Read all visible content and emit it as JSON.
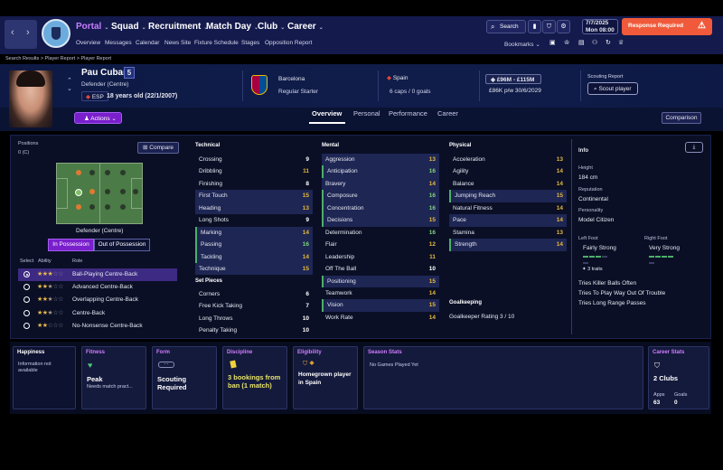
{
  "header": {
    "menus": [
      "Portal",
      "Squad",
      "Recruitment",
      "Match Day",
      "Club",
      "Career"
    ],
    "submenu": [
      "Overview",
      "Messages",
      "Calendar",
      "News Site",
      "Fixture Schedule",
      "Stages",
      "Opposition Report"
    ],
    "search_label": "Search",
    "date_line1": "7/7/2025",
    "date_line2": "Mon  08:00",
    "response_label": "Response Required",
    "bookmarks_label": "Bookmarks"
  },
  "breadcrumb": "Search Results  >  Player Report  >  Player Report",
  "player": {
    "name": "Pau Cubarsí",
    "number": "5",
    "position": "Defender (Centre)",
    "nation_code": "ESP",
    "age": "18 years old (22/1/2007)",
    "club": "Barcelona",
    "club_role": "Regular Starter",
    "nation": "Spain",
    "caps": "6 caps / 0 goals",
    "value": "£96M - £115M",
    "wage": "£86K p/w 30/6/2029",
    "scouting_label": "Scouting Report",
    "scout_button": "Scout player",
    "actions_button": "Actions"
  },
  "profile_tabs": [
    "Overview",
    "Personal",
    "Performance",
    "Career"
  ],
  "comparison_button": "Comparison",
  "positions": {
    "label": "Positions",
    "count": "0 (C)",
    "compare_button": "Compare",
    "role_title": "Defender (Centre)",
    "in_possession": "In Possession",
    "out_possession": "Out of Possession",
    "col_select": "Select",
    "col_ability": "Ability",
    "col_role": "Role",
    "roles": [
      {
        "name": "Ball-Playing Centre-Back",
        "stars": 3,
        "selected": true
      },
      {
        "name": "Advanced Centre-Back",
        "stars": 2.5,
        "selected": false
      },
      {
        "name": "Overlapping Centre-Back",
        "stars": 2.5,
        "selected": false
      },
      {
        "name": "Centre-Back",
        "stars": 2.5,
        "selected": false
      },
      {
        "name": "No-Nonsense Centre-Back",
        "stars": 2,
        "selected": false
      }
    ]
  },
  "technical": {
    "title": "Technical",
    "items": [
      {
        "name": "Crossing",
        "value": "9",
        "hl": false,
        "key": false
      },
      {
        "name": "Dribbling",
        "value": "11",
        "hl": false,
        "key": false
      },
      {
        "name": "Finishing",
        "value": "8",
        "hl": false,
        "key": false
      },
      {
        "name": "First Touch",
        "value": "15",
        "hl": true,
        "key": false
      },
      {
        "name": "Heading",
        "value": "13",
        "hl": true,
        "key": false
      },
      {
        "name": "Long Shots",
        "value": "9",
        "hl": false,
        "key": false
      },
      {
        "name": "Marking",
        "value": "14",
        "hl": true,
        "key": true
      },
      {
        "name": "Passing",
        "value": "16",
        "hl": true,
        "key": true
      },
      {
        "name": "Tackling",
        "value": "14",
        "hl": true,
        "key": true
      },
      {
        "name": "Technique",
        "value": "15",
        "hl": true,
        "key": false
      }
    ]
  },
  "set_pieces": {
    "title": "Set Pieces",
    "items": [
      {
        "name": "Corners",
        "value": "6"
      },
      {
        "name": "Free Kick Taking",
        "value": "7"
      },
      {
        "name": "Long Throws",
        "value": "10"
      },
      {
        "name": "Penalty Taking",
        "value": "10"
      }
    ]
  },
  "mental": {
    "title": "Mental",
    "items": [
      {
        "name": "Aggression",
        "value": "13",
        "hl": true,
        "key": false
      },
      {
        "name": "Anticipation",
        "value": "16",
        "hl": true,
        "key": true
      },
      {
        "name": "Bravery",
        "value": "14",
        "hl": true,
        "key": false
      },
      {
        "name": "Composure",
        "value": "16",
        "hl": true,
        "key": true
      },
      {
        "name": "Concentration",
        "value": "16",
        "hl": true,
        "key": true
      },
      {
        "name": "Decisions",
        "value": "15",
        "hl": true,
        "key": true
      },
      {
        "name": "Determination",
        "value": "16",
        "hl": false,
        "key": false
      },
      {
        "name": "Flair",
        "value": "12",
        "hl": false,
        "key": false
      },
      {
        "name": "Leadership",
        "value": "11",
        "hl": false,
        "key": false
      },
      {
        "name": "Off The Ball",
        "value": "10",
        "hl": false,
        "key": false
      },
      {
        "name": "Positioning",
        "value": "15",
        "hl": true,
        "key": true
      },
      {
        "name": "Teamwork",
        "value": "14",
        "hl": false,
        "key": false
      },
      {
        "name": "Vision",
        "value": "15",
        "hl": true,
        "key": true
      },
      {
        "name": "Work Rate",
        "value": "14",
        "hl": false,
        "key": false
      }
    ]
  },
  "physical": {
    "title": "Physical",
    "items": [
      {
        "name": "Acceleration",
        "value": "13",
        "hl": false,
        "key": false
      },
      {
        "name": "Agility",
        "value": "14",
        "hl": false,
        "key": false
      },
      {
        "name": "Balance",
        "value": "14",
        "hl": false,
        "key": false
      },
      {
        "name": "Jumping Reach",
        "value": "15",
        "hl": true,
        "key": true
      },
      {
        "name": "Natural Fitness",
        "value": "14",
        "hl": false,
        "key": false
      },
      {
        "name": "Pace",
        "value": "14",
        "hl": true,
        "key": false
      },
      {
        "name": "Stamina",
        "value": "13",
        "hl": false,
        "key": false
      },
      {
        "name": "Strength",
        "value": "14",
        "hl": true,
        "key": true
      }
    ]
  },
  "goalkeeping": {
    "title": "Goalkeeping",
    "rating": "Goalkeeper Rating  3 / 10"
  },
  "info": {
    "title": "Info",
    "height_label": "Height",
    "height": "184 cm",
    "rep_label": "Reputation",
    "rep": "Continental",
    "pers_label": "Personality",
    "pers": "Model Citizen",
    "lf_label": "Left Foot",
    "lf": "Fairly Strong",
    "lf_level": 0.6,
    "rf_label": "Right Foot",
    "rf": "Very Strong",
    "rf_level": 0.8,
    "traits_label": "3 traits",
    "traits": [
      "Tries Killer Balls Often",
      "Tries To Play Way Out Of Trouble",
      "Tries Long Range Passes"
    ]
  },
  "cards": {
    "happiness_title": "Happiness",
    "happiness_text": "Information not available",
    "fitness_title": "Fitness",
    "fitness_value": "Peak",
    "fitness_sub": "Needs match pract...",
    "form_title": "Form",
    "form_value": "Scouting Required",
    "form_badge": "- -",
    "discipline_title": "Discipline",
    "discipline_value": "3 bookings from ban (1 match)",
    "eligibility_title": "Eligibility",
    "eligibility_value": "Homegrown player in Spain",
    "season_title": "Season Stats",
    "season_value": "No Games Played Yet",
    "career_title": "Career Stats",
    "career_value": "2 Clubs",
    "apps_label": "Apps",
    "apps": "63",
    "goals_label": "Goals",
    "goals": "0"
  },
  "colors": {
    "accent": "#7a1fcc",
    "header": "#141a4c",
    "response": "#f05a3a",
    "key_attr": "#4caf6a"
  }
}
